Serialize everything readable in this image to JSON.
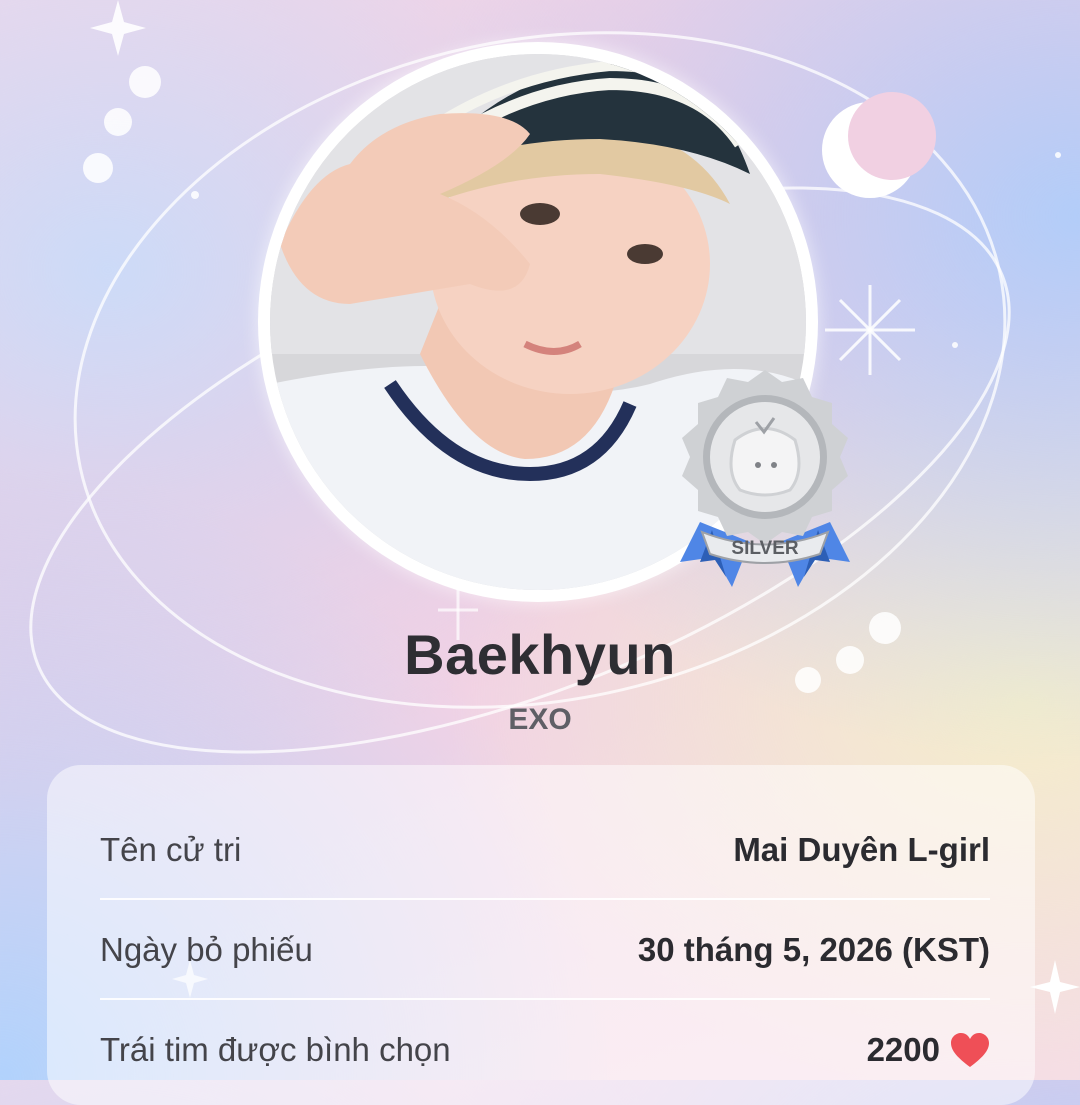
{
  "idol": {
    "name": "Baekhyun",
    "group": "EXO",
    "badge_label": "SILVER"
  },
  "details": [
    {
      "label": "Tên cử tri",
      "value": "Mai Duyên L-girl"
    },
    {
      "label": "Ngày bỏ phiếu",
      "value": "30 tháng 5, 2026 (KST)"
    },
    {
      "label": "Trái tim được bình chọn",
      "value": "2200"
    }
  ],
  "icons": {
    "moon": "crescent-moon-icon",
    "sparkle": "sparkle-icon",
    "heart": "heart-icon",
    "medal": "silver-medal-icon"
  },
  "colors": {
    "heart": "#ef4f57",
    "ribbon": "#4f86e6",
    "medal": "#cfd1d4"
  }
}
